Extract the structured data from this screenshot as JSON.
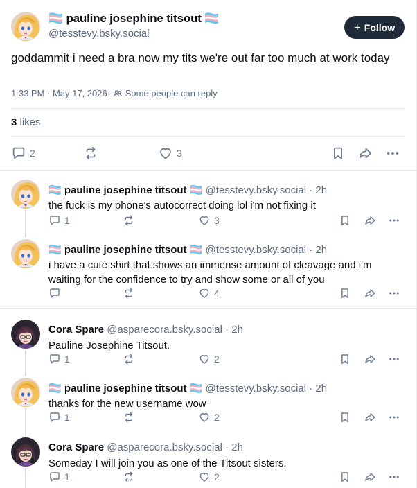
{
  "main_post": {
    "author_name": "🏳️‍⚧️ pauline josephine titsout 🏳️‍⚧️",
    "handle": "@tesstevy.bsky.social",
    "follow_label": "Follow",
    "follow_plus": "+",
    "text": "goddammit i need a bra now my tits we're out far too much at work today",
    "timestamp": "1:33 PM · May 17, 2026",
    "reply_setting": "Some people can reply",
    "likes_count": "3",
    "likes_label": "likes",
    "replies_count": "2",
    "like_count": "3"
  },
  "replies": [
    {
      "name": "🏳️‍⚧️ pauline josephine titsout 🏳️‍⚧️",
      "handle": "@tesstevy.bsky.social",
      "time": "· 2h",
      "text": "the fuck is my phone's autocorrect doing lol i'm not fixing it",
      "reply_count": "1",
      "like_count": "3",
      "avatar": "anime-avatar"
    },
    {
      "name": "🏳️‍⚧️ pauline josephine titsout 🏳️‍⚧️",
      "handle": "@tesstevy.bsky.social",
      "time": "· 2h",
      "text": "i have a cute shirt that shows an immense amount of cleavage and i'm waiting for the confidence to try and show some or all of you",
      "reply_count": "",
      "like_count": "4",
      "avatar": "anime-avatar"
    },
    {
      "name": "Cora Spare",
      "handle": "@asparecora.bsky.social",
      "time": "· 2h",
      "text": "Pauline Josephine Titsout.",
      "reply_count": "1",
      "like_count": "2",
      "avatar": "cora-avatar"
    },
    {
      "name": "🏳️‍⚧️ pauline josephine titsout 🏳️‍⚧️",
      "handle": "@tesstevy.bsky.social",
      "time": "· 2h",
      "text": "thanks for the new username wow",
      "reply_count": "1",
      "like_count": "2",
      "avatar": "anime-avatar"
    },
    {
      "name": "Cora Spare",
      "handle": "@asparecora.bsky.social",
      "time": "· 2h",
      "text": "Someday I will join you as one of the Titsout sisters.",
      "reply_count": "1",
      "like_count": "2",
      "avatar": "cora-avatar"
    }
  ],
  "colors": {
    "text": "#0b0f14",
    "muted": "#5c6b7e",
    "icon": "#6b7a8d",
    "divider": "#e3e8ee",
    "thread_line": "#d4dbe3",
    "follow_bg": "#1e2a38"
  },
  "icons": [
    "reply-icon",
    "repost-icon",
    "like-icon",
    "bookmark-icon",
    "share-icon",
    "more-icon",
    "people-icon"
  ]
}
